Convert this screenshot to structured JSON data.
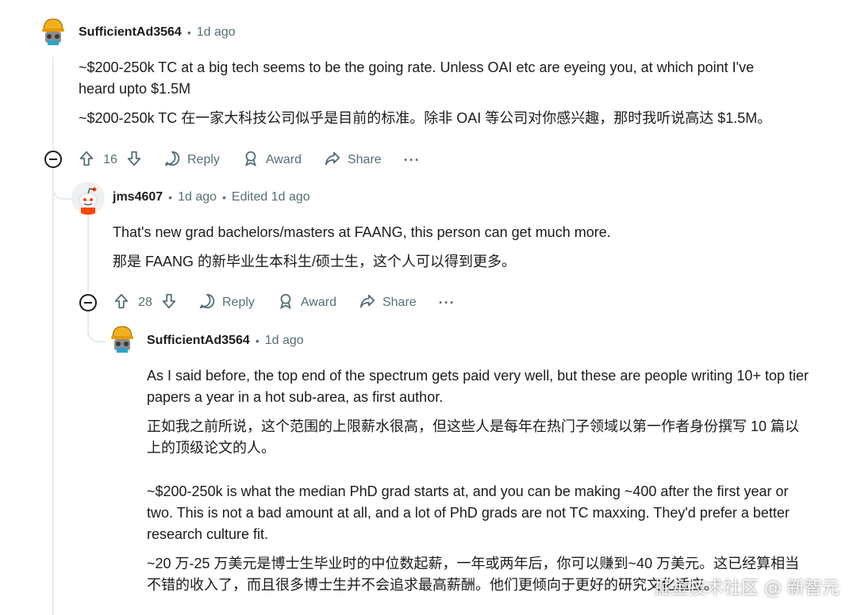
{
  "comments": [
    {
      "username": "SufficientAd3564",
      "time": "1d ago",
      "edited": "",
      "paragraphs": [
        "~$200-250k TC at a big tech seems to be the going rate. Unless OAI etc are eyeing you, at which point I've heard upto $1.5M",
        "~$200-250k TC 在一家大科技公司似乎是目前的标准。除非 OAI 等公司对你感兴趣，那时我听说高达 $1.5M。"
      ],
      "score": "16"
    },
    {
      "username": "jms4607",
      "time": "1d ago",
      "edited": "Edited 1d ago",
      "paragraphs": [
        "That's new grad bachelors/masters at FAANG, this person can get much more.",
        "那是 FAANG 的新毕业生本科生/硕士生，这个人可以得到更多。"
      ],
      "score": "28"
    },
    {
      "username": "SufficientAd3564",
      "time": "1d ago",
      "edited": "",
      "paragraphs": [
        "As I said before, the top end of the spectrum gets paid very well, but these are people writing 10+ top tier papers a year in a hot sub-area, as first author.",
        "正如我之前所说，这个范围的上限薪水很高，但这些人是每年在热门子领域以第一作者身份撰写 10 篇以上的顶级论文的人。",
        "~$200-250k is what the median PhD grad starts at, and you can be making ~400 after the first year or two. This is not a bad amount at all, and a lot of PhD grads are not TC maxxing. They'd prefer a better research culture fit.",
        "~20 万-25 万美元是博士生毕业时的中位数起薪，一年或两年后，你可以赚到~40 万美元。这已经算相当不错的收入了，而且很多博士生并不会追求最高薪酬。他们更倾向于更好的研究文化适应。"
      ]
    }
  ],
  "actions": {
    "reply": "Reply",
    "award": "Award",
    "share": "Share",
    "more": "···"
  },
  "watermark": "掘金技术社区 @ 新智元",
  "icons": [
    "upvote-icon",
    "downvote-icon",
    "reply-icon",
    "award-icon",
    "share-icon",
    "collapse-icon"
  ]
}
